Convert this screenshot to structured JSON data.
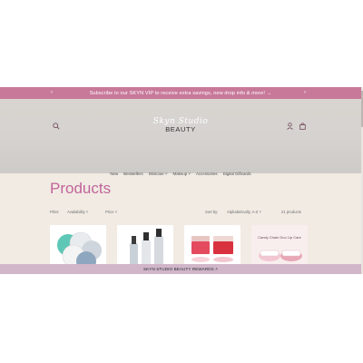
{
  "announcement": {
    "text": "Subscribe to our SKYN VIP to receive extra savings, new drop info & more!",
    "arrow_after": "→",
    "prev_icon": "‹",
    "next_icon": "›"
  },
  "header": {
    "logo_script": "Skyn Studio",
    "logo_main": "BEAUTY",
    "icons": [
      "search-icon",
      "account-icon",
      "cart-icon"
    ]
  },
  "nav": {
    "items": [
      {
        "label": "New"
      },
      {
        "label": "Bestsellers"
      },
      {
        "label": "Skincare ˅"
      },
      {
        "label": "Makeup ˅"
      },
      {
        "label": "Accessories"
      },
      {
        "label": "Digital Giftcards"
      }
    ]
  },
  "collection": {
    "title": "Products",
    "filter_label": "Filter:",
    "availability": "Availability ˅",
    "price": "Price ˅",
    "sort_label": "Sort by:",
    "sort_value": "Alphabetically, A-Z ˅",
    "count": "21 products"
  },
  "products": [
    {
      "label": "",
      "image": "cotton-rounds"
    },
    {
      "label": "",
      "image": "serum-bottles"
    },
    {
      "label": "",
      "image": "lip-pots"
    },
    {
      "label": "Candy Chain Duo Lip Care",
      "image": "lip-care-duo"
    }
  ],
  "rewards": {
    "text": "SKYN STUDIO BEAUTY REWARDS",
    "icon": "chevron-up-icon",
    "icon_glyph": "˄"
  },
  "colors": {
    "announcement_bg": "#c8799a",
    "page_bg": "#f1ebe4",
    "title": "#c2649a",
    "rewards_bg": "#d0b6c8"
  }
}
